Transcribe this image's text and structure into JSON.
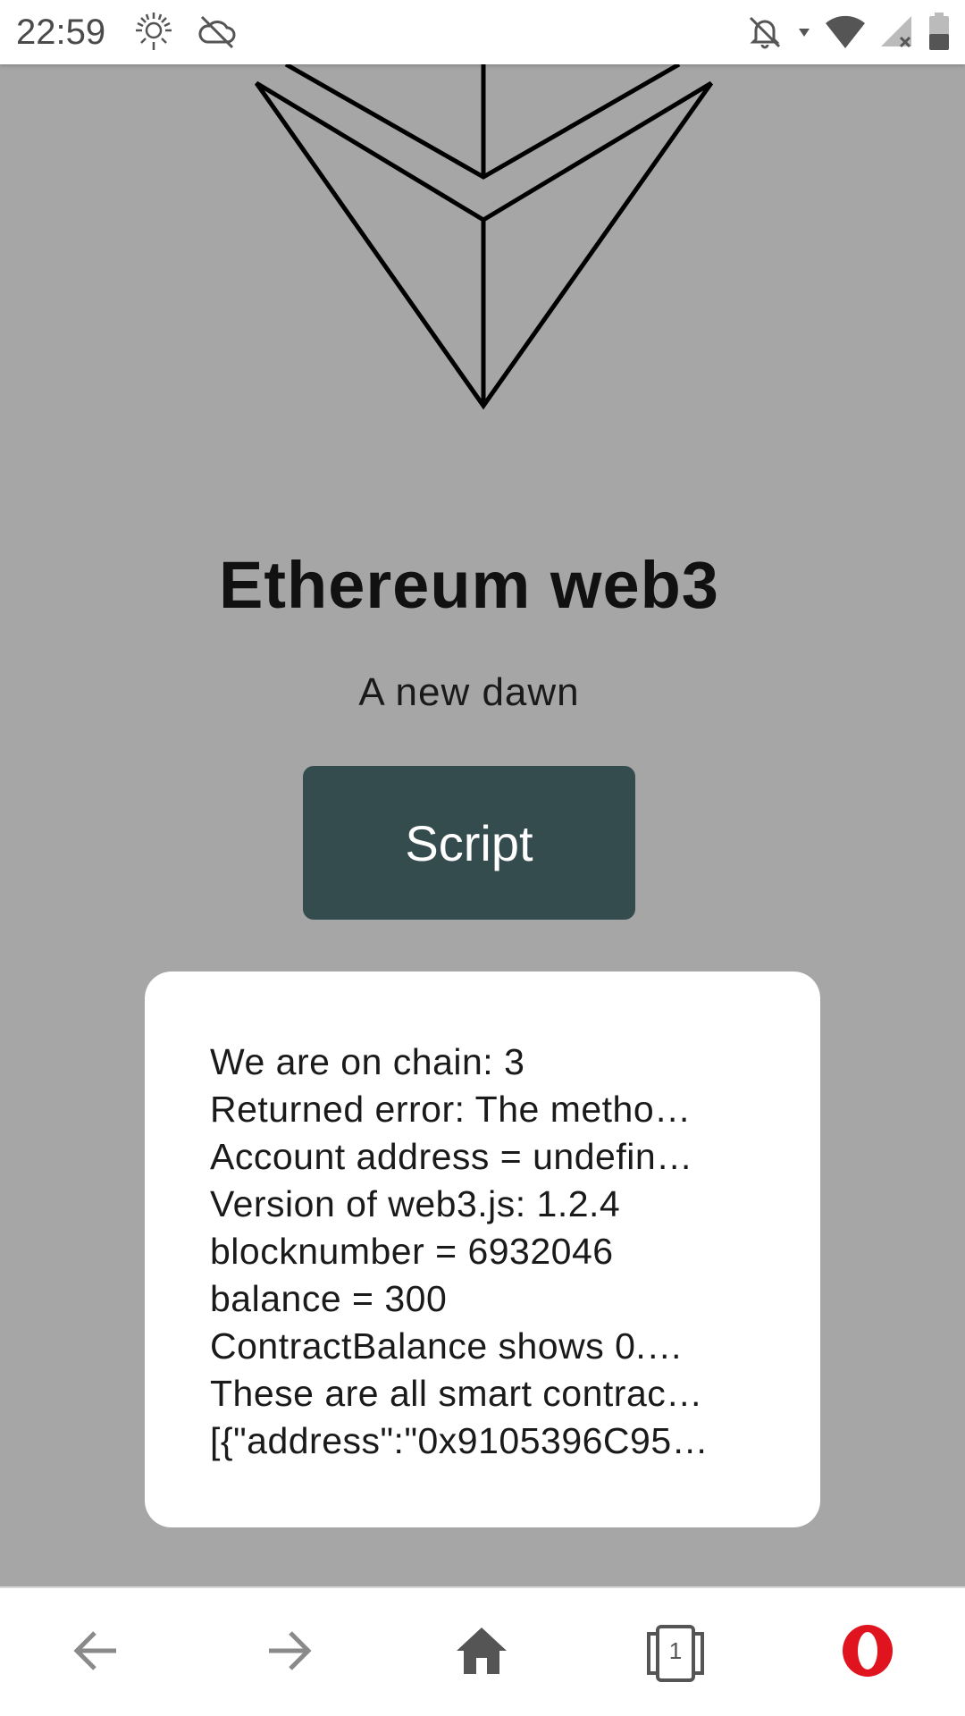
{
  "status_bar": {
    "time": "22:59",
    "left_icons": [
      "sun-settings-icon",
      "sync-off-icon"
    ],
    "right_icons": [
      "notifications-off-icon",
      "data-arrow-icon",
      "wifi-icon",
      "cell-signal-no-service-icon",
      "battery-icon"
    ]
  },
  "page": {
    "logo": "ethereum-logo-icon",
    "title": "Ethereum web3",
    "subtitle": "A new dawn",
    "button_label": "Script",
    "output_lines": [
      "We are on chain: 3",
      "Returned error: The metho…",
      "Account address = undefin…",
      "Version of web3.js: 1.2.4",
      "blocknumber = 6932046",
      "balance = 300",
      "ContractBalance shows 0.…",
      "These are all smart contrac…",
      "[{\"address\":\"0x9105396C95…"
    ]
  },
  "bottom_nav": {
    "items": [
      "back-arrow-icon",
      "forward-arrow-icon",
      "home-icon",
      "tabs-icon",
      "opera-menu-icon"
    ],
    "tabs_count": "1"
  },
  "colors": {
    "page_background": "#a6a6a6",
    "button_background": "#354c4e",
    "button_text": "#ffffff",
    "card_background": "#ffffff",
    "opera_red": "#e0141e"
  }
}
